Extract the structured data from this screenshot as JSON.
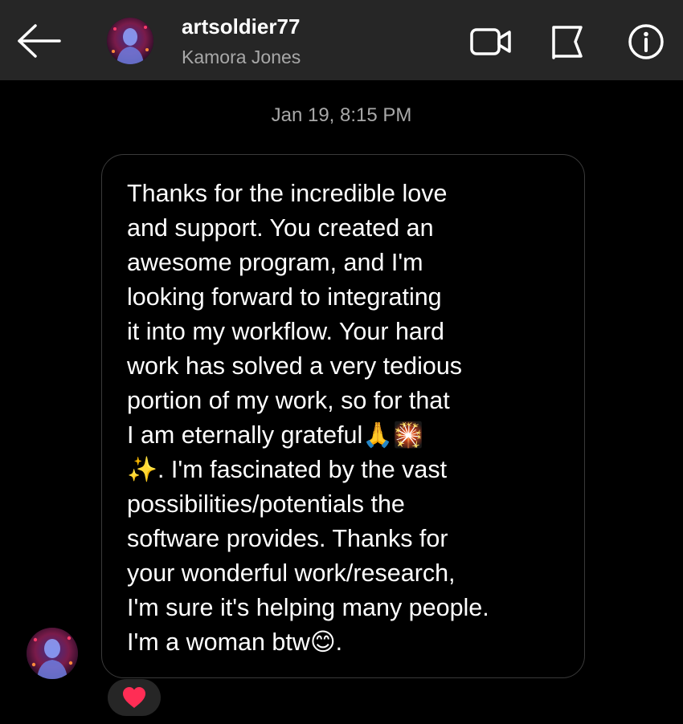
{
  "header": {
    "back_icon": "arrow-left-icon",
    "username": "artsoldier77",
    "full_name": "Kamora Jones",
    "video_call_icon": "video-camera-icon",
    "flag_icon": "flag-icon",
    "info_icon": "info-icon",
    "background": "#262626"
  },
  "conversation": {
    "timestamp": "Jan 19, 8:15 PM",
    "message": "Thanks for the incredible love\nand support. You created an\nawesome program, and I'm\nlooking forward to integrating\nit into my workflow. Your hard\nwork has solved a very tedious\nportion of my work, so for that\nI am eternally grateful🙏🎇\n✨. I'm fascinated by the vast\npossibilities/potentials the\nsoftware provides. Thanks for\nyour wonderful work/research,\nI'm sure it's helping many people.\nI'm a woman btw😊.",
    "reaction": "❤️",
    "bubble_border": "#3a3a3a"
  }
}
